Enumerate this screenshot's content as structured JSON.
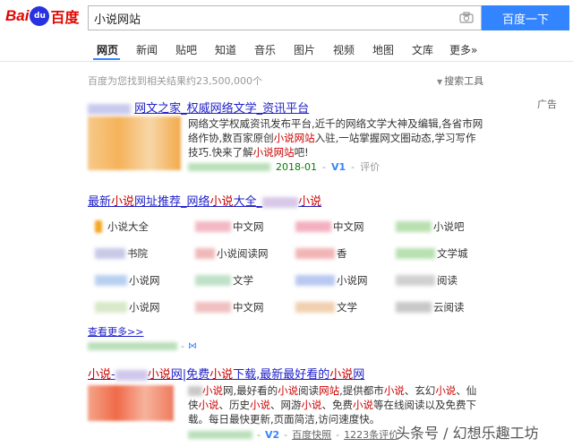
{
  "header": {
    "logo_bai": "Bai",
    "logo_du": "du",
    "logo_cn": "百度",
    "search_value": "小说网站",
    "search_button": "百度一下"
  },
  "nav": {
    "tabs": [
      "网页",
      "新闻",
      "贴吧",
      "知道",
      "音乐",
      "图片",
      "视频",
      "地图",
      "文库",
      "更多»"
    ],
    "active_index": 0
  },
  "results_meta": {
    "stats": "百度为您找到相关结果约23,500,000个",
    "tools_label": "搜索工具"
  },
  "ad_result": {
    "badge": "广告",
    "title_text": "网文之家_权威网络文学_资讯平台",
    "desc_part1": "网络文学权威资讯发布平台,近千的网络文学大神及编辑,各省市网络作协,数百家原创",
    "desc_red1": "小说网站",
    "desc_part2": "入驻,一站掌握网文圈动态,学习写作技巧.快来了解",
    "desc_red2": "小说网站",
    "desc_part3": "吧!",
    "date": "2018-01",
    "v_badge": "V1",
    "eval": "评价"
  },
  "site_list": {
    "title_part1": "最新",
    "title_red1": "小说",
    "title_part2": "网址推荐_网络",
    "title_red2": "小说",
    "title_part3": "大全_",
    "title_red3": "小说",
    "items": [
      "小说大全",
      "中文网",
      "中文网",
      "小说吧",
      "书院",
      "小说阅读网",
      "香",
      "文学城",
      "小说网",
      "文学",
      "小说网",
      "阅读",
      "小说网",
      "中文网",
      "文学",
      "云阅读"
    ],
    "more_link": "查看更多>>"
  },
  "result3": {
    "title_red1": "小说",
    "title_part1": "-",
    "title_red2": "小说",
    "title_part2": "网|免费",
    "title_red3": "小说",
    "title_part3": "下载,最新最好看的",
    "title_red4": "小说",
    "title_part4": "网",
    "desc_line1_red1": "小说",
    "desc_line1_a": "网,最好看的",
    "desc_line1_red2": "小说",
    "desc_line1_b": "阅读",
    "desc_line1_red3": "网站",
    "desc_line1_c": ",提供都市",
    "desc_line1_red4": "小说",
    "desc_line1_d": "、玄幻",
    "desc_line1_red5": "小说",
    "desc_line1_e": "、仙侠",
    "desc_line2_red1": "小说",
    "desc_line2_a": "、历史",
    "desc_line2_red2": "小说",
    "desc_line2_b": "、网游",
    "desc_line2_red3": "小说",
    "desc_line2_c": "、免费",
    "desc_line2_red4": "小说",
    "desc_line2_d": "等在线阅读以及免费下载。每日最快更新,页面简洁,访问速度快。",
    "v_badge": "V2",
    "snapshot": "百度快照",
    "reviews": "1223条评价"
  },
  "watermark": "头条号 / 幻想乐趣工坊",
  "colors": {
    "accent": "#3385ff",
    "link": "#2020c8",
    "highlight": "#cc0000",
    "url": "#008000"
  }
}
